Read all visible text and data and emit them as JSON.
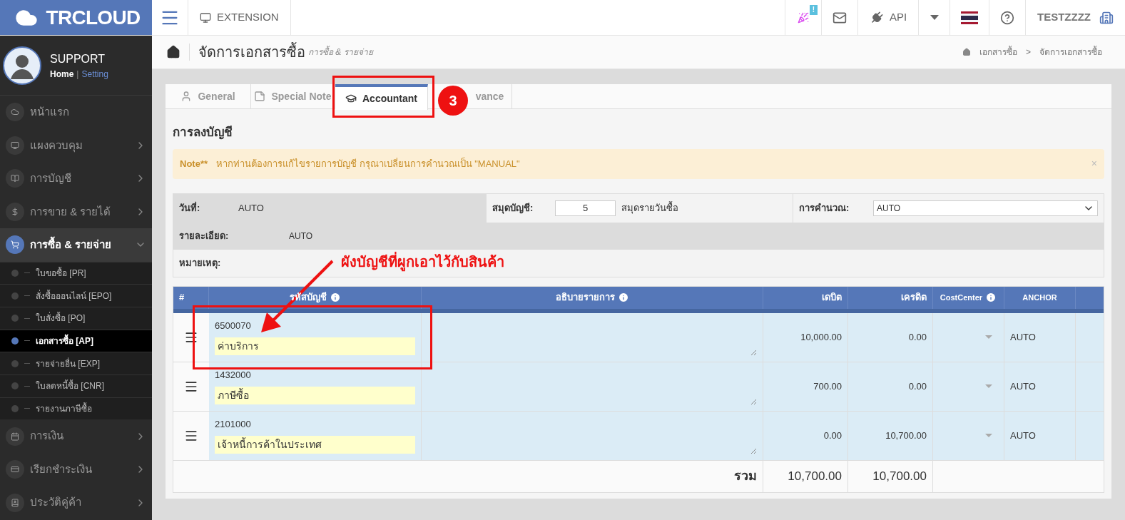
{
  "logo": {
    "text": "TRCLOUD"
  },
  "topbar": {
    "extension": "EXTENSION",
    "badge": "!",
    "api": "API",
    "user": "TESTZZZZ"
  },
  "profile": {
    "name": "SUPPORT",
    "home": "Home",
    "separator": "|",
    "setting": "Setting"
  },
  "sidebar": {
    "items": [
      {
        "label": "หน้าแรก",
        "expanded": false,
        "selected": false,
        "has_chevron": false
      },
      {
        "label": "แผงควบคุม",
        "expanded": false,
        "selected": false,
        "has_chevron": true
      },
      {
        "label": "การบัญชี",
        "expanded": false,
        "selected": false,
        "has_chevron": true
      },
      {
        "label": "การขาย & รายได้",
        "expanded": false,
        "selected": false,
        "has_chevron": true
      },
      {
        "label": "การซื้อ & รายจ่าย",
        "expanded": true,
        "selected": true,
        "has_chevron": true,
        "children": [
          {
            "label": "ใบขอซื้อ [PR]",
            "selected": false
          },
          {
            "label": "สั่งซื้อออนไลน์ [EPO]",
            "selected": false
          },
          {
            "label": "ใบสั่งซื้อ [PO]",
            "selected": false
          },
          {
            "label": "เอกสารซื้อ [AP]",
            "selected": true
          },
          {
            "label": "รายจ่ายอื่น [EXP]",
            "selected": false
          },
          {
            "label": "ใบลดหนี้ซื้อ [CNR]",
            "selected": false
          },
          {
            "label": "รายงานภาษีซื้อ",
            "selected": false
          }
        ]
      },
      {
        "label": "การเงิน",
        "expanded": false,
        "selected": false,
        "has_chevron": true
      },
      {
        "label": "เรียกชำระเงิน",
        "expanded": false,
        "selected": false,
        "has_chevron": true
      },
      {
        "label": "ประวัติคู่ค้า",
        "expanded": false,
        "selected": false,
        "has_chevron": true
      }
    ]
  },
  "page": {
    "title": "จัดการเอกสารซื้อ",
    "subtitle": "การซื้อ & รายจ่าย",
    "breadcrumb": [
      "เอกสารซื้อ",
      ">",
      "จัดการเอกสารซื้อ"
    ]
  },
  "tabs": [
    {
      "label": "General",
      "selected": false
    },
    {
      "label": "Special Note",
      "selected": false
    },
    {
      "label": "Accountant",
      "selected": true
    },
    {
      "label": "vance",
      "selected": false
    }
  ],
  "section_title": "การลงบัญชี",
  "note": {
    "label": "Note**",
    "text": "หากท่านต้องการแก้ไขรายการบัญชี กรุณาเปลี่ยนการคำนวณเป็น \"MANUAL\"",
    "close": "×"
  },
  "form": {
    "date_label": "วันที่:",
    "date_value": "AUTO",
    "journal_label": "สมุดบัญชี:",
    "journal_value": "5",
    "journal_name": "สมุดรายวันซื้อ",
    "calc_label": "การคำนวณ:",
    "calc_value": "AUTO",
    "detail_label": "รายละเอียด:",
    "detail_value": "AUTO",
    "remark_label": "หมายเหตุ:"
  },
  "table": {
    "columns": [
      "#",
      "รหัสบัญชี",
      "อธิบายรายการ",
      "เดบิต",
      "เครดิต",
      "CostCenter",
      "ANCHOR"
    ],
    "rows": [
      {
        "code": "6500070",
        "name": "ค่าบริการ",
        "debit": "10,000.00",
        "credit": "0.00",
        "anchor": "AUTO"
      },
      {
        "code": "1432000",
        "name": "ภาษีซื้อ",
        "debit": "700.00",
        "credit": "0.00",
        "anchor": "AUTO"
      },
      {
        "code": "2101000",
        "name": "เจ้าหนี้การค้าในประเทศ",
        "debit": "0.00",
        "credit": "10,700.00",
        "anchor": "AUTO"
      }
    ],
    "total_label": "รวม",
    "total_debit": "10,700.00",
    "total_credit": "10,700.00"
  },
  "annotations": {
    "step": "3",
    "callout": "ผังบัญชีที่ผูกเอาไว้กับสินค้า"
  }
}
